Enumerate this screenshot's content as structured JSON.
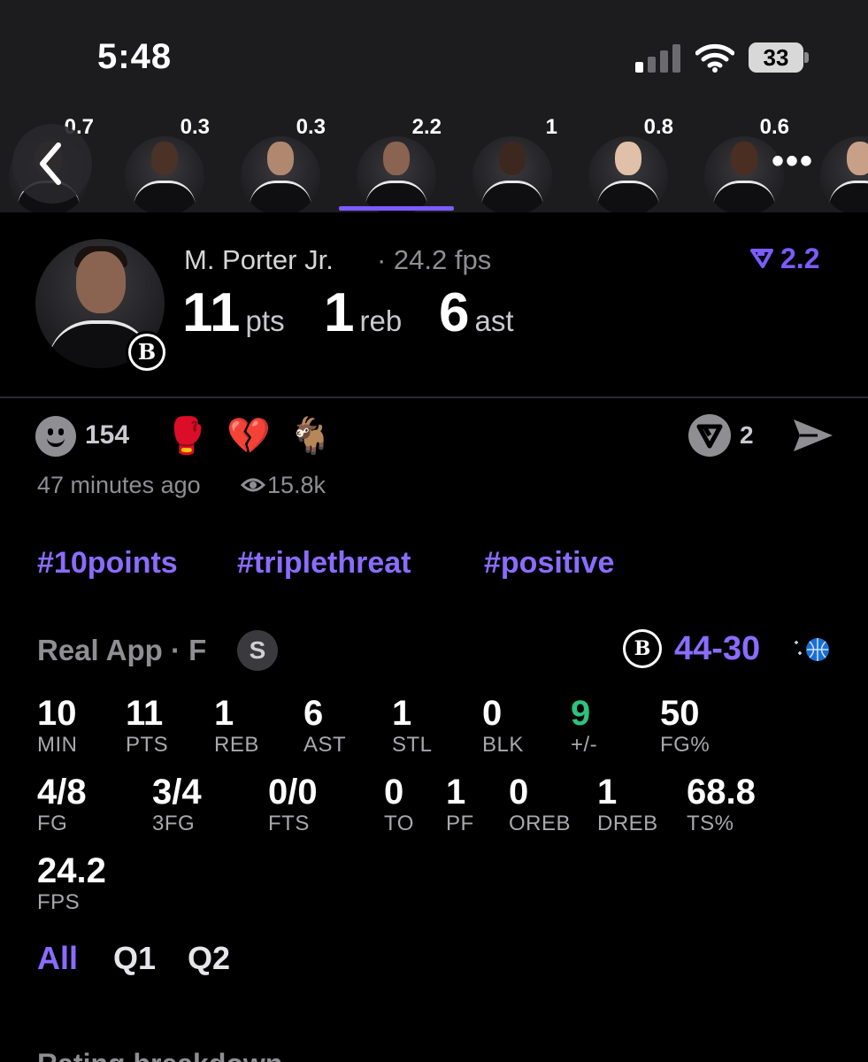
{
  "status_bar": {
    "time": "5:48",
    "battery": "33"
  },
  "player_strip": {
    "items": [
      {
        "value": "0.7"
      },
      {
        "value": "0.3"
      },
      {
        "value": "0.3"
      },
      {
        "value": "2.2",
        "selected": true
      },
      {
        "value": "1"
      },
      {
        "value": "0.8"
      },
      {
        "value": "0.6"
      },
      {
        "value": ""
      }
    ],
    "more_label": "•••"
  },
  "player": {
    "name": "M. Porter Jr.",
    "fps": "· 24.2 fps",
    "rating": "2.2",
    "team_badge": "B",
    "headline": {
      "pts_value": "11",
      "pts_label": "pts",
      "reb_value": "1",
      "reb_label": "reb",
      "ast_value": "6",
      "ast_label": "ast"
    }
  },
  "reactions": {
    "count": "154",
    "emojis": [
      "🥊",
      "💔",
      "🐐"
    ],
    "v_count": "2",
    "timestamp": "47 minutes ago",
    "views": "15.8k"
  },
  "hashtags": [
    "#10points",
    "#triplethreat",
    "#positive"
  ],
  "game": {
    "label": "Real App · F",
    "s_badge": "S",
    "home_logo": "B",
    "score": "44-30"
  },
  "stats_row1": [
    {
      "value": "10",
      "label": "MIN"
    },
    {
      "value": "11",
      "label": "PTS"
    },
    {
      "value": "1",
      "label": "REB"
    },
    {
      "value": "6",
      "label": "AST"
    },
    {
      "value": "1",
      "label": "STL"
    },
    {
      "value": "0",
      "label": "BLK"
    },
    {
      "value": "9",
      "label": "+/-"
    },
    {
      "value": "50",
      "label": "FG%"
    }
  ],
  "stats_row2": [
    {
      "value": "4/8",
      "label": "FG"
    },
    {
      "value": "3/4",
      "label": "3FG"
    },
    {
      "value": "0/0",
      "label": "FTS"
    },
    {
      "value": "0",
      "label": "TO"
    },
    {
      "value": "1",
      "label": "PF"
    },
    {
      "value": "0",
      "label": "OREB"
    },
    {
      "value": "1",
      "label": "DREB"
    },
    {
      "value": "68.8",
      "label": "TS%"
    }
  ],
  "stats_row3": [
    {
      "value": "24.2",
      "label": "FPS"
    }
  ],
  "quarter_tabs": [
    {
      "label": "All",
      "active": true
    },
    {
      "label": "Q1",
      "active": false
    },
    {
      "label": "Q2",
      "active": false
    }
  ],
  "section_title": "Rating breakdown",
  "colors": {
    "accent": "#8b6cff",
    "positive": "#2ec27e",
    "background": "#000000",
    "header_bg": "#1c1c1e"
  }
}
